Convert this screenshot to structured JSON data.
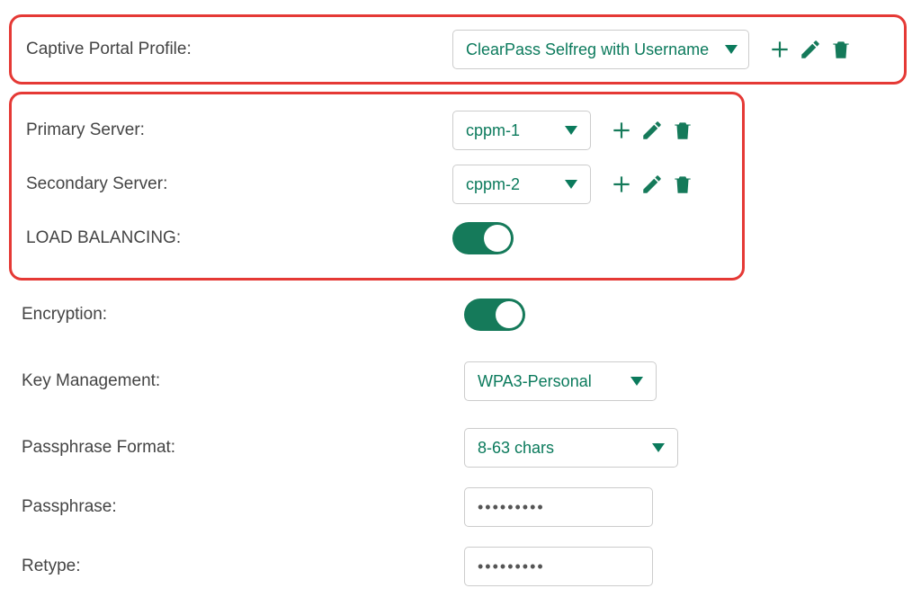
{
  "colors": {
    "accent": "#157a5a",
    "highlight_border": "#e53935"
  },
  "captive_portal": {
    "label": "Captive Portal Profile:",
    "value": "ClearPass Selfreg with Username"
  },
  "servers": {
    "primary_label": "Primary Server:",
    "primary_value": "cppm-1",
    "secondary_label": "Secondary Server:",
    "secondary_value": "cppm-2",
    "load_balancing_label": "LOAD BALANCING:",
    "load_balancing_on": true
  },
  "encryption": {
    "label": "Encryption:",
    "on": true
  },
  "key_management": {
    "label": "Key Management:",
    "value": "WPA3-Personal"
  },
  "passphrase_format": {
    "label": "Passphrase Format:",
    "value": "8-63 chars"
  },
  "passphrase": {
    "label": "Passphrase:",
    "value": "•••••••••"
  },
  "retype": {
    "label": "Retype:",
    "value": "•••••••••"
  },
  "icons": {
    "plus": "plus-icon",
    "pencil": "pencil-icon",
    "trash": "trash-icon",
    "caret": "caret-down-icon"
  }
}
